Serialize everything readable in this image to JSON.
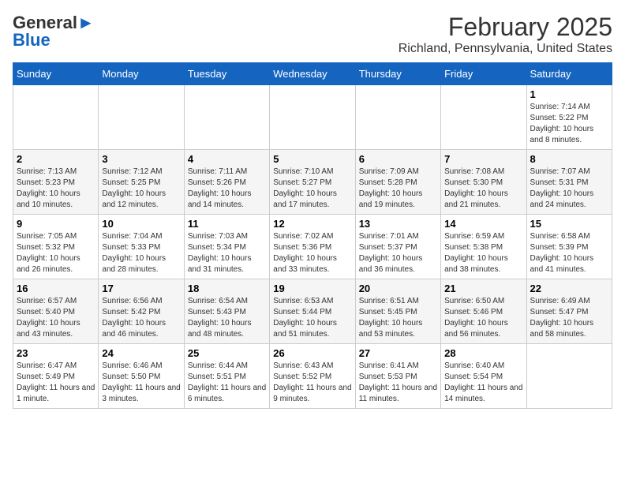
{
  "header": {
    "logo_line1": "General",
    "logo_line2": "Blue",
    "title": "February 2025",
    "subtitle": "Richland, Pennsylvania, United States"
  },
  "days_of_week": [
    "Sunday",
    "Monday",
    "Tuesday",
    "Wednesday",
    "Thursday",
    "Friday",
    "Saturday"
  ],
  "weeks": [
    [
      {
        "num": "",
        "info": ""
      },
      {
        "num": "",
        "info": ""
      },
      {
        "num": "",
        "info": ""
      },
      {
        "num": "",
        "info": ""
      },
      {
        "num": "",
        "info": ""
      },
      {
        "num": "",
        "info": ""
      },
      {
        "num": "1",
        "info": "Sunrise: 7:14 AM\nSunset: 5:22 PM\nDaylight: 10 hours and 8 minutes."
      }
    ],
    [
      {
        "num": "2",
        "info": "Sunrise: 7:13 AM\nSunset: 5:23 PM\nDaylight: 10 hours and 10 minutes."
      },
      {
        "num": "3",
        "info": "Sunrise: 7:12 AM\nSunset: 5:25 PM\nDaylight: 10 hours and 12 minutes."
      },
      {
        "num": "4",
        "info": "Sunrise: 7:11 AM\nSunset: 5:26 PM\nDaylight: 10 hours and 14 minutes."
      },
      {
        "num": "5",
        "info": "Sunrise: 7:10 AM\nSunset: 5:27 PM\nDaylight: 10 hours and 17 minutes."
      },
      {
        "num": "6",
        "info": "Sunrise: 7:09 AM\nSunset: 5:28 PM\nDaylight: 10 hours and 19 minutes."
      },
      {
        "num": "7",
        "info": "Sunrise: 7:08 AM\nSunset: 5:30 PM\nDaylight: 10 hours and 21 minutes."
      },
      {
        "num": "8",
        "info": "Sunrise: 7:07 AM\nSunset: 5:31 PM\nDaylight: 10 hours and 24 minutes."
      }
    ],
    [
      {
        "num": "9",
        "info": "Sunrise: 7:05 AM\nSunset: 5:32 PM\nDaylight: 10 hours and 26 minutes."
      },
      {
        "num": "10",
        "info": "Sunrise: 7:04 AM\nSunset: 5:33 PM\nDaylight: 10 hours and 28 minutes."
      },
      {
        "num": "11",
        "info": "Sunrise: 7:03 AM\nSunset: 5:34 PM\nDaylight: 10 hours and 31 minutes."
      },
      {
        "num": "12",
        "info": "Sunrise: 7:02 AM\nSunset: 5:36 PM\nDaylight: 10 hours and 33 minutes."
      },
      {
        "num": "13",
        "info": "Sunrise: 7:01 AM\nSunset: 5:37 PM\nDaylight: 10 hours and 36 minutes."
      },
      {
        "num": "14",
        "info": "Sunrise: 6:59 AM\nSunset: 5:38 PM\nDaylight: 10 hours and 38 minutes."
      },
      {
        "num": "15",
        "info": "Sunrise: 6:58 AM\nSunset: 5:39 PM\nDaylight: 10 hours and 41 minutes."
      }
    ],
    [
      {
        "num": "16",
        "info": "Sunrise: 6:57 AM\nSunset: 5:40 PM\nDaylight: 10 hours and 43 minutes."
      },
      {
        "num": "17",
        "info": "Sunrise: 6:56 AM\nSunset: 5:42 PM\nDaylight: 10 hours and 46 minutes."
      },
      {
        "num": "18",
        "info": "Sunrise: 6:54 AM\nSunset: 5:43 PM\nDaylight: 10 hours and 48 minutes."
      },
      {
        "num": "19",
        "info": "Sunrise: 6:53 AM\nSunset: 5:44 PM\nDaylight: 10 hours and 51 minutes."
      },
      {
        "num": "20",
        "info": "Sunrise: 6:51 AM\nSunset: 5:45 PM\nDaylight: 10 hours and 53 minutes."
      },
      {
        "num": "21",
        "info": "Sunrise: 6:50 AM\nSunset: 5:46 PM\nDaylight: 10 hours and 56 minutes."
      },
      {
        "num": "22",
        "info": "Sunrise: 6:49 AM\nSunset: 5:47 PM\nDaylight: 10 hours and 58 minutes."
      }
    ],
    [
      {
        "num": "23",
        "info": "Sunrise: 6:47 AM\nSunset: 5:49 PM\nDaylight: 11 hours and 1 minute."
      },
      {
        "num": "24",
        "info": "Sunrise: 6:46 AM\nSunset: 5:50 PM\nDaylight: 11 hours and 3 minutes."
      },
      {
        "num": "25",
        "info": "Sunrise: 6:44 AM\nSunset: 5:51 PM\nDaylight: 11 hours and 6 minutes."
      },
      {
        "num": "26",
        "info": "Sunrise: 6:43 AM\nSunset: 5:52 PM\nDaylight: 11 hours and 9 minutes."
      },
      {
        "num": "27",
        "info": "Sunrise: 6:41 AM\nSunset: 5:53 PM\nDaylight: 11 hours and 11 minutes."
      },
      {
        "num": "28",
        "info": "Sunrise: 6:40 AM\nSunset: 5:54 PM\nDaylight: 11 hours and 14 minutes."
      },
      {
        "num": "",
        "info": ""
      }
    ]
  ]
}
